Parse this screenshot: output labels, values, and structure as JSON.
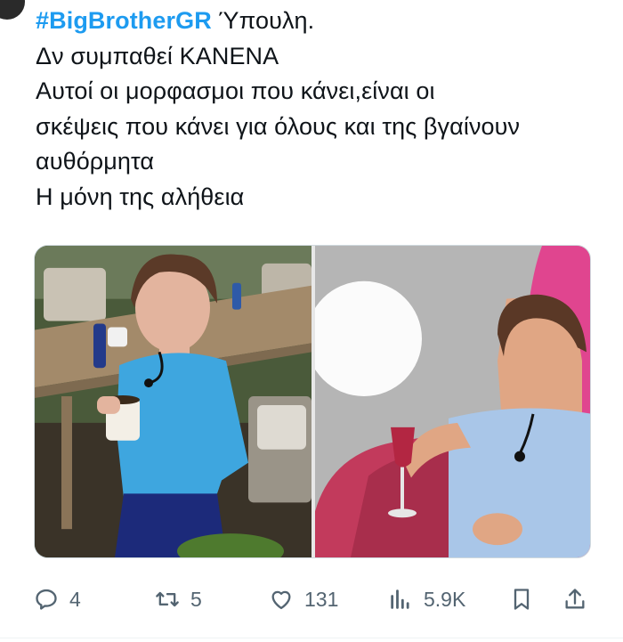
{
  "tweet": {
    "hashtag": "#BigBrotherGR",
    "line1_rest": " Ύπουλη.",
    "line2": "Δν συμπαθεί ΚΑΝΕΝΑ",
    "line3": "Αυτοί οι μορφασμοι που κάνει,είναι οι",
    "line4": "σκέψεις που κάνει για όλους και της βγαίνουν",
    "line5": "αυθόρμητα",
    "line6": "Η μόνη της αλήθεια"
  },
  "media": {
    "images": [
      {
        "name": "woman-in-blue-holding-mug-photo"
      },
      {
        "name": "woman-on-pink-chair-holding-wine-photo"
      }
    ]
  },
  "actions": {
    "reply": {
      "icon": "reply-icon",
      "count": "4"
    },
    "retweet": {
      "icon": "retweet-icon",
      "count": "5"
    },
    "like": {
      "icon": "heart-icon",
      "count": "131"
    },
    "views": {
      "icon": "views-chart-icon",
      "count": "5.9K"
    },
    "bookmark": {
      "icon": "bookmark-icon"
    },
    "share": {
      "icon": "share-icon"
    }
  },
  "colors": {
    "hashtag": "#1d9bf0",
    "text": "#0f1419",
    "icon": "#536471"
  }
}
